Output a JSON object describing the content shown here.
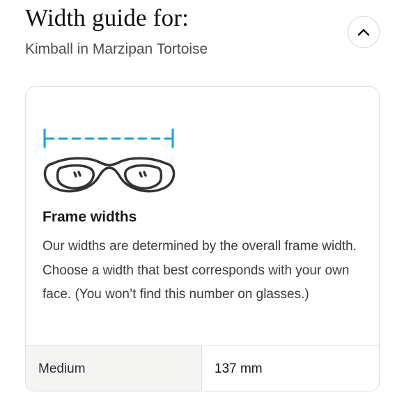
{
  "header": {
    "title": "Width guide for:",
    "subtitle": "Kimball in Marzipan Tortoise",
    "collapse_icon": "chevron-up-icon"
  },
  "card": {
    "illustration_icon": "glasses-width-icon",
    "heading": "Frame widths",
    "body": "Our widths are determined by the overall frame width. Choose a width that best corresponds with your own face. (You won’t find this number on glasses.)",
    "widths": [
      {
        "name": "Medium",
        "value": "137 mm"
      }
    ]
  },
  "colors": {
    "accent_measure": "#1aa0d8",
    "line_art": "#333333",
    "table_label_bg": "#f4f5f3",
    "border": "#dedede"
  }
}
